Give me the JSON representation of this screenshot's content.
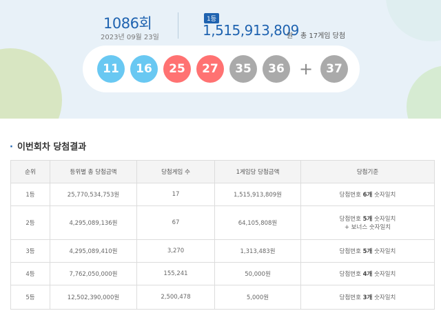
{
  "draw": {
    "round": "1086회",
    "date": "2023년 09월 23일",
    "rank_badge": "1등",
    "first_prize": "1,515,913,809",
    "prize_unit": "원",
    "winners_text": "총 17게임 당첨"
  },
  "balls": [
    {
      "num": "11",
      "color": "#69c8f2"
    },
    {
      "num": "16",
      "color": "#69c8f2"
    },
    {
      "num": "25",
      "color": "#ff7272"
    },
    {
      "num": "27",
      "color": "#ff7272"
    },
    {
      "num": "35",
      "color": "#aaaaaa"
    },
    {
      "num": "36",
      "color": "#aaaaaa"
    }
  ],
  "plus": "+",
  "bonus": {
    "num": "37",
    "color": "#aaaaaa"
  },
  "section_title": "이번회차 당첨결과",
  "table": {
    "headers": [
      "순위",
      "등위별 총 당첨금액",
      "당첨게임 수",
      "1게임당 당첨금액",
      "당첨기준"
    ],
    "rows": [
      {
        "rank": "1등",
        "total": "25,770,534,753원",
        "games": "17",
        "per_game": "1,515,913,809원",
        "crit_a": "당첨번호",
        "crit_b": "6개",
        "crit_c": "숫자일치",
        "crit_extra": ""
      },
      {
        "rank": "2등",
        "total": "4,295,089,136원",
        "games": "67",
        "per_game": "64,105,808원",
        "crit_a": "당첨번호",
        "crit_b": "5개",
        "crit_c": "숫자일치",
        "crit_extra": "+ 보너스 숫자일치"
      },
      {
        "rank": "3등",
        "total": "4,295,089,410원",
        "games": "3,270",
        "per_game": "1,313,483원",
        "crit_a": "당첨번호",
        "crit_b": "5개",
        "crit_c": "숫자일치",
        "crit_extra": ""
      },
      {
        "rank": "4등",
        "total": "7,762,050,000원",
        "games": "155,241",
        "per_game": "50,000원",
        "crit_a": "당첨번호",
        "crit_b": "4개",
        "crit_c": "숫자일치",
        "crit_extra": ""
      },
      {
        "rank": "5등",
        "total": "12,502,390,000원",
        "games": "2,500,478",
        "per_game": "5,000원",
        "crit_a": "당첨번호",
        "crit_b": "3개",
        "crit_c": "숫자일치",
        "crit_extra": ""
      }
    ]
  }
}
